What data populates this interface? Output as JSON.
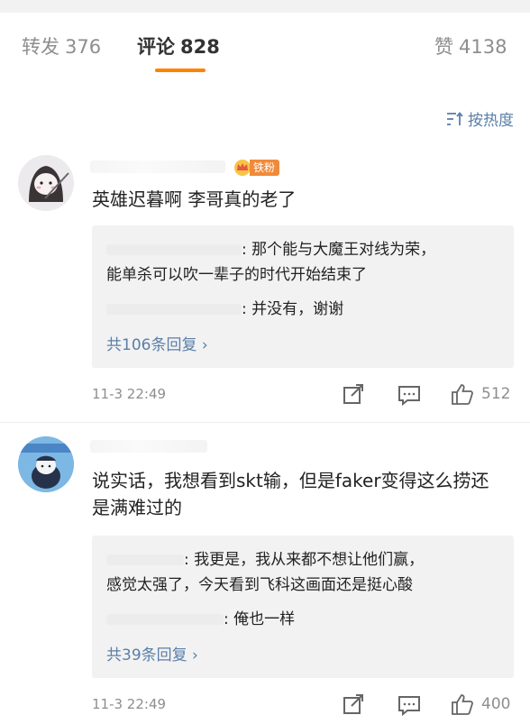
{
  "tabs": {
    "reposts": {
      "label": "转发",
      "count": "376"
    },
    "comments": {
      "label": "评论",
      "count": "828"
    },
    "likes": {
      "label": "赞",
      "count": "4138"
    }
  },
  "sort": {
    "label": "按热度"
  },
  "comments": [
    {
      "badge": "铁粉",
      "text": "英雄迟暮啊 李哥真的老了",
      "replies": [
        {
          "text": ": 那个能与大魔王对线为荣，"
        },
        {
          "text": "能单杀可以吹一辈子的时代开始结束了"
        },
        {
          "text": ": 并没有，谢谢"
        }
      ],
      "more_replies": "共106条回复 ›",
      "time": "11-3 22:49",
      "likes": "512"
    },
    {
      "text": "说实话，我想看到skt输，但是faker变得这么捞还是满难过的",
      "replies": [
        {
          "text": ": 我更是，我从来都不想让他们赢，"
        },
        {
          "text": "感觉太强了，今天看到飞科这画面还是挺心酸"
        },
        {
          "text": ": 俺也一样"
        }
      ],
      "more_replies": "共39条回复 ›",
      "time": "11-3 22:49",
      "likes": "400"
    }
  ],
  "colors": {
    "accent": "#ff8200",
    "link": "#5a7fa8",
    "badge": "#f08a3a"
  }
}
